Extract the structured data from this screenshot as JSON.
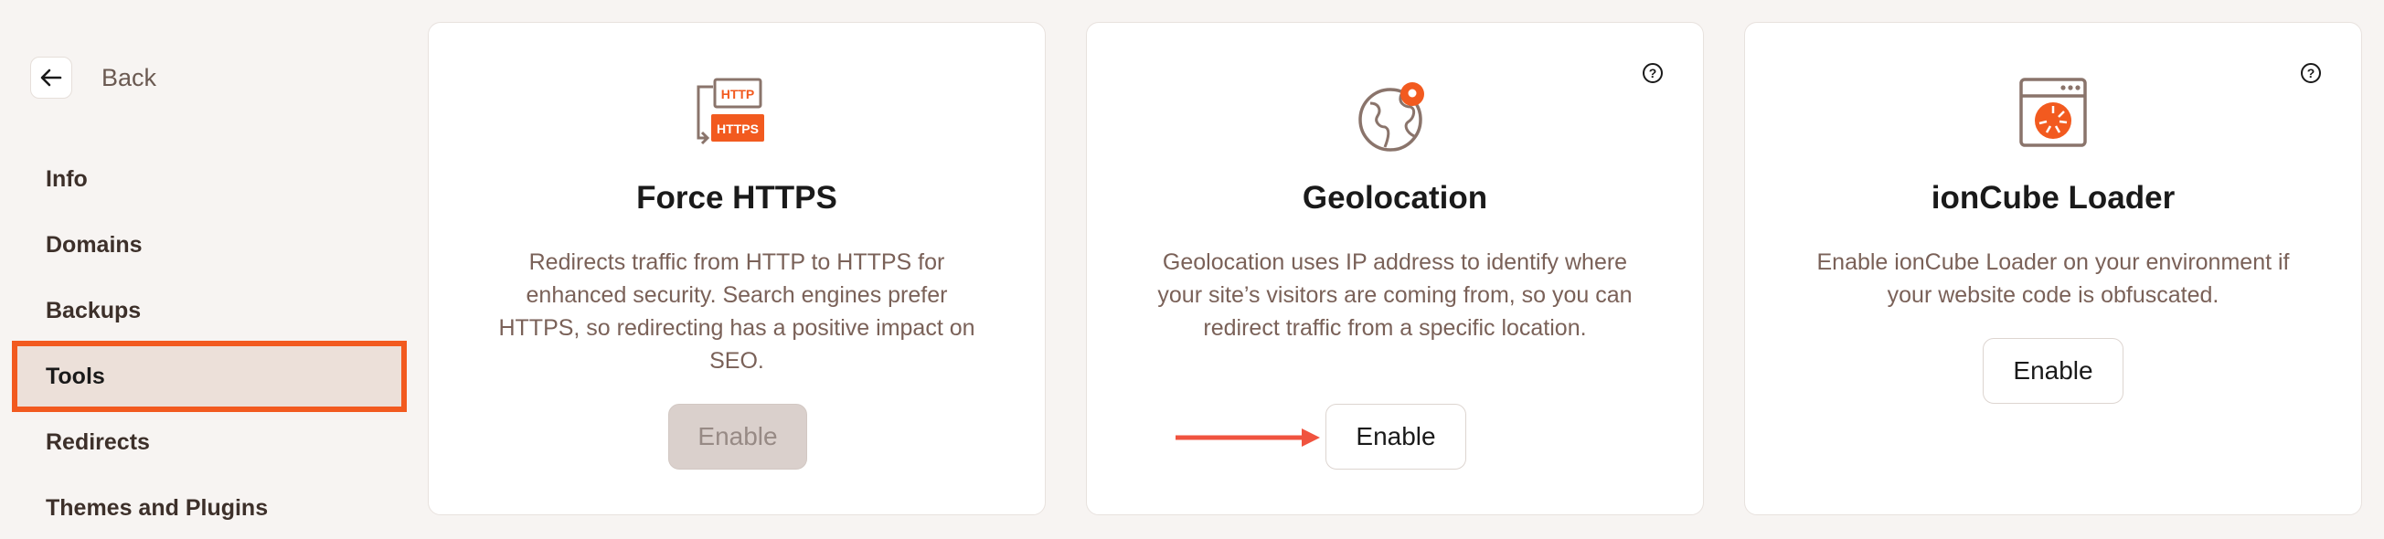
{
  "sidebar": {
    "back_label": "Back",
    "items": [
      {
        "label": "Info"
      },
      {
        "label": "Domains"
      },
      {
        "label": "Backups"
      },
      {
        "label": "Tools"
      },
      {
        "label": "Redirects"
      },
      {
        "label": "Themes and Plugins"
      }
    ],
    "active_item": "Tools"
  },
  "cards": [
    {
      "title": "Force HTTPS",
      "description": "Redirects traffic from HTTP to HTTPS for enhanced security. Search engines prefer HTTPS, so redirecting has a positive impact on SEO.",
      "button_label": "Enable",
      "button_state": "disabled",
      "icon": "https-redirect-icon",
      "icon_labels": {
        "top": "HTTP",
        "bottom": "HTTPS"
      }
    },
    {
      "title": "Geolocation",
      "description": "Geolocation uses IP address to identify where your site’s visitors are coming from, so you can redirect traffic from a specific location.",
      "button_label": "Enable",
      "button_state": "enabled",
      "icon": "globe-location-icon",
      "help": "?"
    },
    {
      "title": "ionCube Loader",
      "description": "Enable ionCube Loader on your environment if your website code is obfuscated.",
      "button_label": "Enable",
      "button_state": "enabled",
      "icon": "ioncube-browser-icon",
      "help": "?"
    }
  ],
  "colors": {
    "accent": "#f25a1f",
    "highlight_arrow": "#f0533f",
    "icon_stroke": "#8a746b",
    "background": "#f7f4f2"
  }
}
